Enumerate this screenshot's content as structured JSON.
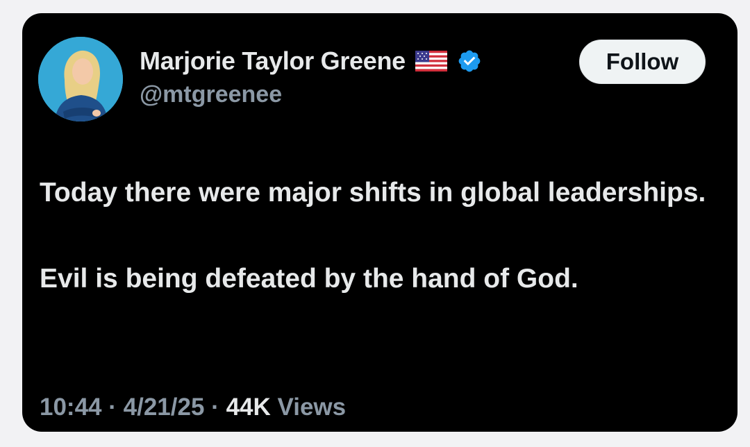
{
  "author": {
    "display_name": "Marjorie Taylor Greene",
    "handle": "@mtgreenee",
    "flag_icon": "us-flag-icon",
    "verified_icon": "verified-badge-icon",
    "verified_color": "#1d9bf0"
  },
  "follow_button": {
    "label": "Follow"
  },
  "tweet": {
    "paragraph_1": "Today there were major shifts in global leaderships.",
    "paragraph_2": "Evil is being defeated by the hand of God."
  },
  "meta": {
    "time": "10:44",
    "separator": "·",
    "date": "4/21/25",
    "views_count": "44K",
    "views_label": "Views"
  },
  "colors": {
    "card_background": "#000000",
    "text_primary": "#e7e9ea",
    "text_secondary": "#8b98a5",
    "follow_button_bg": "#eff3f4"
  }
}
